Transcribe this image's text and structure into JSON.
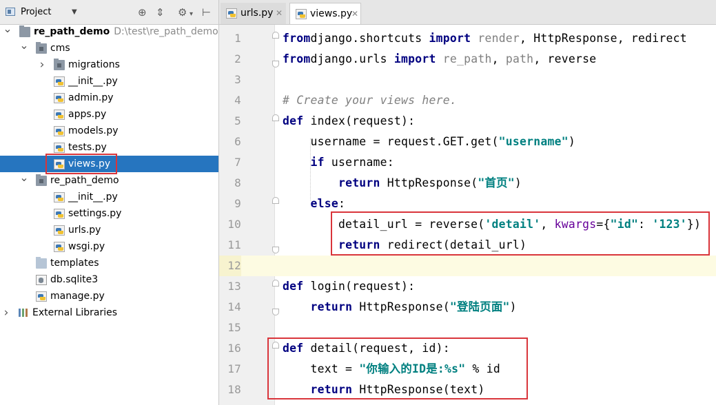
{
  "project_panel": {
    "title": "Project",
    "tree": [
      {
        "label": "re_path_demo",
        "path": "D:\\test\\re_path_demo",
        "kind": "root",
        "expanded": true,
        "depth": 0
      },
      {
        "label": "cms",
        "kind": "package",
        "expanded": true,
        "depth": 1
      },
      {
        "label": "migrations",
        "kind": "package",
        "expanded": false,
        "depth": 2
      },
      {
        "label": "__init__.py",
        "kind": "py",
        "depth": 2
      },
      {
        "label": "admin.py",
        "kind": "py",
        "depth": 2
      },
      {
        "label": "apps.py",
        "kind": "py",
        "depth": 2
      },
      {
        "label": "models.py",
        "kind": "py",
        "depth": 2
      },
      {
        "label": "tests.py",
        "kind": "py",
        "depth": 2
      },
      {
        "label": "views.py",
        "kind": "py",
        "depth": 2,
        "selected": true
      },
      {
        "label": "re_path_demo",
        "kind": "package",
        "expanded": true,
        "depth": 1
      },
      {
        "label": "__init__.py",
        "kind": "py",
        "depth": 2
      },
      {
        "label": "settings.py",
        "kind": "py",
        "depth": 2
      },
      {
        "label": "urls.py",
        "kind": "py",
        "depth": 2
      },
      {
        "label": "wsgi.py",
        "kind": "py",
        "depth": 2
      },
      {
        "label": "templates",
        "kind": "folder",
        "depth": 1
      },
      {
        "label": "db.sqlite3",
        "kind": "db",
        "depth": 1
      },
      {
        "label": "manage.py",
        "kind": "py",
        "depth": 1
      },
      {
        "label": "External Libraries",
        "kind": "libs",
        "expanded": false,
        "depth": 0
      }
    ]
  },
  "tabs": [
    {
      "label": "urls.py",
      "active": false
    },
    {
      "label": "views.py",
      "active": true
    }
  ],
  "editor": {
    "current_line": 12,
    "lines": [
      {
        "n": "1",
        "tokens": [
          [
            "kw",
            "from"
          ],
          [
            "",
            "django.shortcuts "
          ],
          [
            "kw",
            "import"
          ],
          [
            "dim",
            " render"
          ],
          [
            "",
            ", HttpResponse, redirect"
          ]
        ]
      },
      {
        "n": "2",
        "tokens": [
          [
            "kw",
            "from"
          ],
          [
            "",
            "django.urls "
          ],
          [
            "kw",
            "import"
          ],
          [
            "dim",
            " re_path"
          ],
          [
            "",
            ", "
          ],
          [
            "dim",
            "path"
          ],
          [
            "",
            ", reverse"
          ]
        ]
      },
      {
        "n": "3",
        "tokens": []
      },
      {
        "n": "4",
        "tokens": [
          [
            "cmt",
            "# Create your views here."
          ]
        ]
      },
      {
        "n": "5",
        "tokens": [
          [
            "kw",
            "def"
          ],
          [
            "",
            " index(request):"
          ]
        ]
      },
      {
        "n": "6",
        "tokens": [
          [
            "",
            "    username = request.GET.get("
          ],
          [
            "str",
            "\"username\""
          ],
          [
            "",
            ")"
          ]
        ]
      },
      {
        "n": "7",
        "tokens": [
          [
            "",
            "    "
          ],
          [
            "kw",
            "if"
          ],
          [
            "",
            " username:"
          ]
        ]
      },
      {
        "n": "8",
        "tokens": [
          [
            "",
            "        "
          ],
          [
            "kw",
            "return"
          ],
          [
            "",
            " HttpResponse("
          ],
          [
            "str",
            "\"首页\""
          ],
          [
            "",
            ")"
          ]
        ]
      },
      {
        "n": "9",
        "tokens": [
          [
            "",
            "    "
          ],
          [
            "kw",
            "else"
          ],
          [
            "",
            ":"
          ]
        ]
      },
      {
        "n": "10",
        "tokens": [
          [
            "",
            "        detail_url = reverse("
          ],
          [
            "str",
            "'detail'"
          ],
          [
            "",
            ", "
          ],
          [
            "kwarg",
            "kwargs"
          ],
          [
            "",
            "={"
          ],
          [
            "str",
            "\"id\""
          ],
          [
            "",
            ": "
          ],
          [
            "str",
            "'123'"
          ],
          [
            "",
            "})"
          ]
        ]
      },
      {
        "n": "11",
        "tokens": [
          [
            "",
            "        "
          ],
          [
            "kw",
            "return"
          ],
          [
            "",
            " redirect(detail_url)"
          ]
        ]
      },
      {
        "n": "12",
        "tokens": []
      },
      {
        "n": "13",
        "tokens": [
          [
            "kw",
            "def"
          ],
          [
            "",
            " login(request):"
          ]
        ]
      },
      {
        "n": "14",
        "tokens": [
          [
            "",
            "    "
          ],
          [
            "kw",
            "return"
          ],
          [
            "",
            " HttpResponse("
          ],
          [
            "str",
            "\"登陆页面\""
          ],
          [
            "",
            ")"
          ]
        ]
      },
      {
        "n": "15",
        "tokens": []
      },
      {
        "n": "16",
        "tokens": [
          [
            "kw",
            "def"
          ],
          [
            "",
            " detail(request, id):"
          ]
        ]
      },
      {
        "n": "17",
        "tokens": [
          [
            "",
            "    text = "
          ],
          [
            "str",
            "\"你输入的ID是:%s\""
          ],
          [
            "",
            " % id"
          ]
        ]
      },
      {
        "n": "18",
        "tokens": [
          [
            "",
            "    "
          ],
          [
            "kw",
            "return"
          ],
          [
            "",
            " HttpResponse(text)"
          ]
        ]
      }
    ]
  },
  "colors": {
    "selection": "#2675bf",
    "keyword": "#000080",
    "string": "#008080",
    "comment": "#808080",
    "highlight_box": "#d9343a"
  }
}
